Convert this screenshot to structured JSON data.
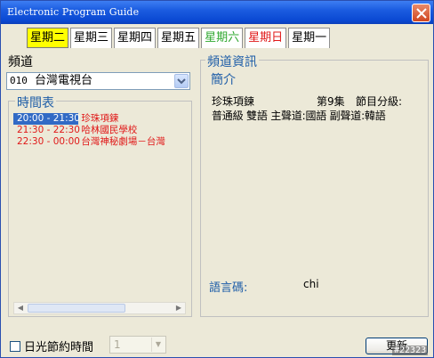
{
  "window": {
    "title": "Electronic Program Guide"
  },
  "tabs": [
    {
      "label": "星期二",
      "color": "#000000",
      "active": true
    },
    {
      "label": "星期三",
      "color": "#000000",
      "active": false
    },
    {
      "label": "星期四",
      "color": "#000000",
      "active": false
    },
    {
      "label": "星期五",
      "color": "#000000",
      "active": false
    },
    {
      "label": "星期六",
      "color": "#2fa82f",
      "active": false
    },
    {
      "label": "星期日",
      "color": "#e01818",
      "active": false
    },
    {
      "label": "星期一",
      "color": "#000000",
      "active": false
    }
  ],
  "channel": {
    "label": "頻道",
    "number": "010",
    "name": "台灣電視台"
  },
  "schedule": {
    "label": "時間表",
    "items": [
      {
        "time": "20:00 - 21:30",
        "title": "珍珠項鍊",
        "selected": true
      },
      {
        "time": "21:30 - 22:30",
        "title": "哈林國民學校",
        "selected": false
      },
      {
        "time": "22:30 - 00:00",
        "title": "台灣神秘劇場－台灣",
        "selected": false
      }
    ]
  },
  "info": {
    "label": "頻道資訊",
    "intro_label": "簡介",
    "program": "珍珠項鍊",
    "episode": "第9集",
    "rating_label": "節目分級:",
    "details": "普通級  雙語  主聲道:國語 副聲道:韓語",
    "language_label": "語言碼:",
    "language_value": "chi"
  },
  "footer": {
    "dst_label": "日光節約時間",
    "tz_value": "1",
    "refresh_label": "更新"
  },
  "watermark": "#22323",
  "colors": {
    "titlebar": "#0a48d2",
    "accent_text": "#1f5ea8",
    "program_text": "#e01818",
    "selection": "#316ac5",
    "active_tab": "#ffff00"
  }
}
